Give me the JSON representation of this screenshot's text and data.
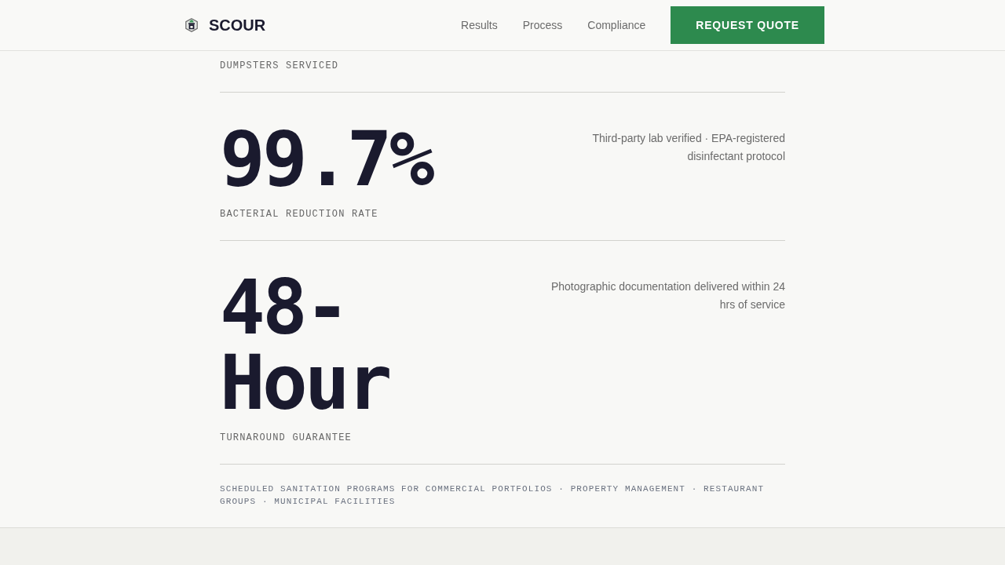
{
  "header": {
    "brand": "SCOUR",
    "nav": [
      "Results",
      "Process",
      "Compliance"
    ],
    "cta": "REQUEST QUOTE"
  },
  "stats": [
    {
      "label": "DUMPSTERS SERVICED"
    },
    {
      "value": "99.7%",
      "label": "BACTERIAL REDUCTION RATE",
      "note": "Third-party lab verified · EPA-registered disinfectant protocol"
    },
    {
      "value": "48-Hour",
      "label": "TURNAROUND GUARANTEE",
      "note": "Photographic documentation delivered within 24 hrs of service"
    }
  ],
  "footer_note": "SCHEDULED SANITATION PROGRAMS FOR COMMERCIAL PORTFOLIOS · PROPERTY MANAGEMENT · RESTAURANT GROUPS · MUNICIPAL FACILITIES"
}
